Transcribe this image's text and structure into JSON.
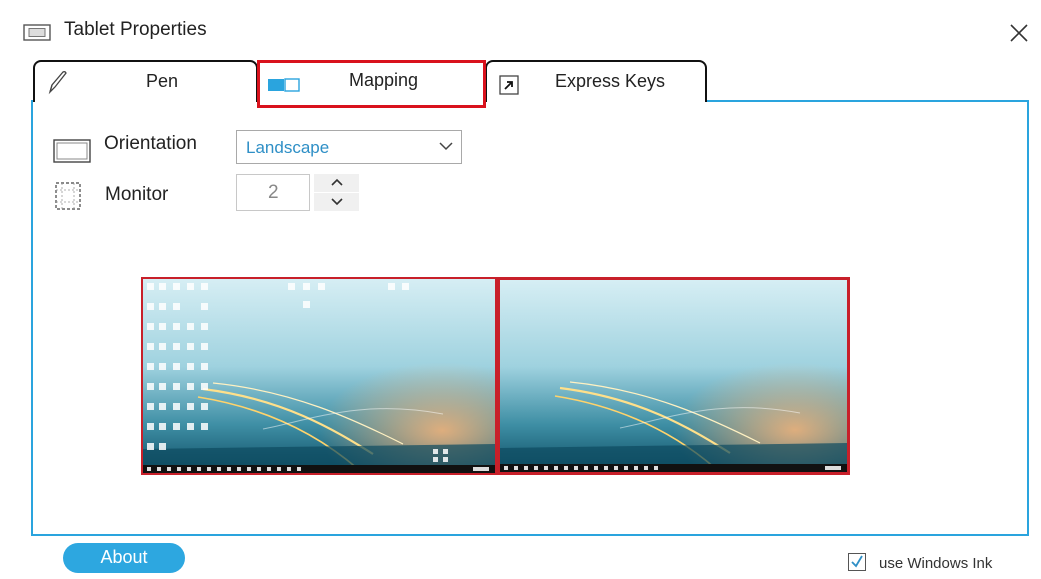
{
  "window": {
    "title": "Tablet Properties",
    "icon": "tablet-window-icon",
    "close_icon": "close-icon"
  },
  "tabs": [
    {
      "label": "Pen",
      "icon": "pen-icon",
      "selected": false
    },
    {
      "label": "Mapping",
      "icon": "mapping-icon",
      "selected": true
    },
    {
      "label": "Express Keys",
      "icon": "express-keys-icon",
      "selected": false
    }
  ],
  "mapping": {
    "orientation": {
      "label": "Orientation",
      "icon": "orientation-icon",
      "value": "Landscape"
    },
    "monitor": {
      "label": "Monitor",
      "icon": "monitor-icon",
      "value": "2"
    },
    "displays": [
      {
        "name": "monitor-1",
        "desktop_icons": true
      },
      {
        "name": "monitor-2",
        "selected": true,
        "desktop_icons": false
      }
    ]
  },
  "footer": {
    "about_label": "About",
    "ink_label": "use Windows Ink",
    "ink_checked": true
  },
  "colors": {
    "accent": "#2da7e0",
    "panel_border": "#2aa4de",
    "highlight": "#d9121d",
    "dropdown_text": "#2e8fc6"
  }
}
